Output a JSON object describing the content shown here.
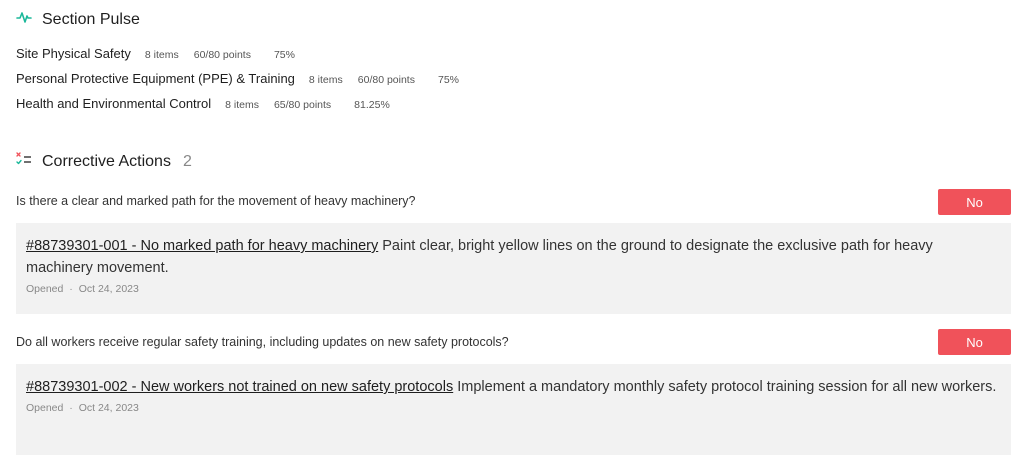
{
  "section_pulse": {
    "title": "Section Pulse",
    "icon": "activity-icon",
    "accent_color": "#1bb89a",
    "rows": [
      {
        "name": "Site Physical Safety",
        "items": "8 items",
        "points": "60/80 points",
        "percent": "75%"
      },
      {
        "name": "Personal Protective Equipment (PPE) & Training",
        "items": "8 items",
        "points": "60/80 points",
        "percent": "75%"
      },
      {
        "name": "Health and Environmental Control",
        "items": "8 items",
        "points": "65/80 points",
        "percent": "81.25%"
      }
    ]
  },
  "corrective_actions": {
    "title": "Corrective Actions",
    "count": "2",
    "icon": "checklist-icon",
    "no_color": "#f0525a",
    "items": [
      {
        "question": "Is there a clear and marked path for the movement of heavy machinery?",
        "answer": "No",
        "link": "#88739301-001 - No marked path for heavy machinery",
        "description": " Paint clear, bright yellow lines on the ground to designate the exclusive path for heavy machinery movement.",
        "status": "Opened",
        "date": "Oct 24, 2023"
      },
      {
        "question": "Do all workers receive regular safety training, including updates on new safety protocols?",
        "answer": "No",
        "link": "#88739301-002 - New workers not trained on new safety protocols",
        "description": " Implement a mandatory monthly safety protocol training session for all new workers.",
        "status": "Opened",
        "date": "Oct 24, 2023"
      }
    ]
  }
}
